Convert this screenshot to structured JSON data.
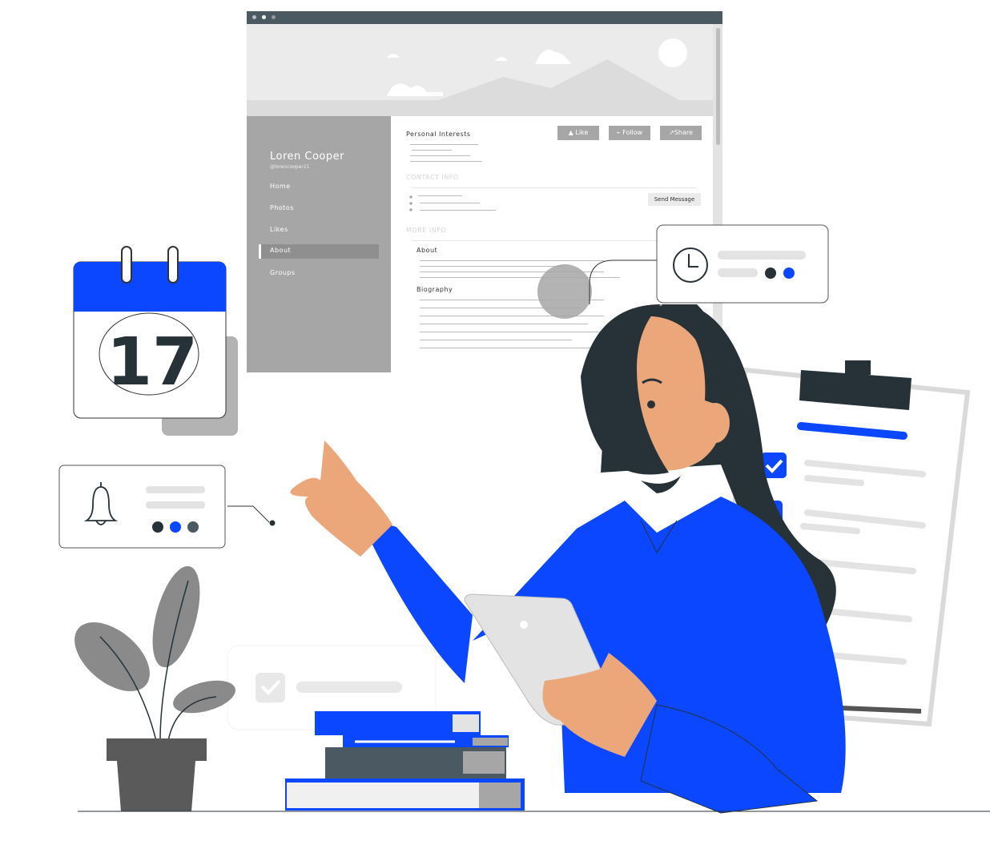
{
  "profile": {
    "name": "Loren Cooper",
    "handle": "@lorencooper21",
    "nav": [
      {
        "label": "Home",
        "active": false
      },
      {
        "label": "Photos",
        "active": false
      },
      {
        "label": "Likes",
        "active": false
      },
      {
        "label": "About",
        "active": true
      },
      {
        "label": "Groups",
        "active": false
      }
    ],
    "section_personal": "Personal Interests",
    "buttons": {
      "like": "Like",
      "follow": "Follow",
      "share": "Share",
      "send_message": "Send Message"
    },
    "section_contact": "CONTACT INFO",
    "section_more": "MORE INFO",
    "about_label": "About",
    "biography_label": "Biography"
  },
  "calendar": {
    "day": "17"
  },
  "colors": {
    "accent": "#0a47ff",
    "dark": "#263238",
    "skin": "#eba67a",
    "gray": "#a6a6a6"
  }
}
